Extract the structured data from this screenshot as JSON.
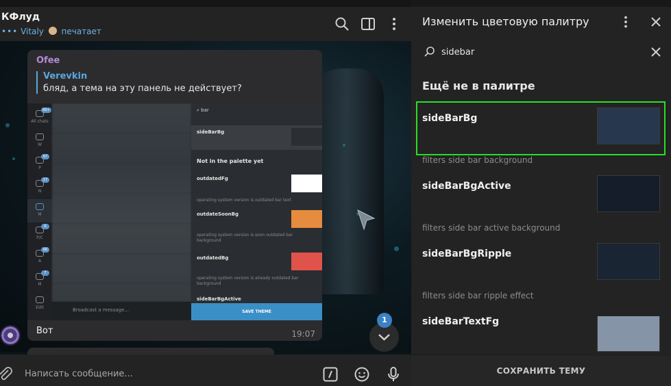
{
  "chat": {
    "title": "КФлуд",
    "status_dots": "•••",
    "status_user": "Vitaly",
    "status_text": "печатает",
    "message": {
      "author": "Ofee",
      "reply_author": "Verevkin",
      "reply_text": "бляд, а тема на эту панель не действует?",
      "text": "Вот",
      "time": "19:07"
    },
    "unread_count": "1",
    "composer_placeholder": "Написать сообщение..."
  },
  "screenshot": {
    "rail": [
      {
        "label": "All chats",
        "badge": "99+"
      },
      {
        "label": "W",
        "badge": ""
      },
      {
        "label": "P",
        "badge": "67"
      },
      {
        "label": "N",
        "badge": "17"
      },
      {
        "label": "M",
        "badge": ""
      },
      {
        "label": "P/C",
        "badge": "6"
      },
      {
        "label": "A",
        "badge": "66"
      },
      {
        "label": "M",
        "badge": "7"
      },
      {
        "label": "Edit",
        "badge": ""
      }
    ],
    "search": "bar",
    "compose_placeholder": "Broadcast a message...",
    "panel_items": [
      {
        "title": "sideBarBg",
        "desc": "",
        "color": "#2b2f34"
      },
      {
        "title": "outdatedFg",
        "desc": "operating system version is outdated bar text",
        "color": "#ffffff"
      },
      {
        "title": "outdateSoonBg",
        "desc": "operating system version is soon outdated bar background",
        "color": "#e68c3e"
      },
      {
        "title": "outdatedBg",
        "desc": "operating system version is already outdated bar background",
        "color": "#e0534a"
      },
      {
        "title": "sideBarBgActive",
        "desc": "",
        "color": "#2b2f34"
      }
    ],
    "section": "Not in the palette yet",
    "save_label": "SAVE THEME"
  },
  "panel": {
    "title": "Изменить цветовую палитру",
    "search_value": "sidebar",
    "section_title": "Ещё не в палитре",
    "items": [
      {
        "name": "sideBarBg",
        "desc": "filters side bar background",
        "color": "#27374d"
      },
      {
        "name": "sideBarBgActive",
        "desc": "filters side bar active background",
        "color": "#141d29"
      },
      {
        "name": "sideBarBgRipple",
        "desc": "filters side bar ripple effect",
        "color": "#1a2533"
      },
      {
        "name": "sideBarTextFg",
        "desc": "",
        "color": "#8594a6"
      }
    ],
    "save_label": "СОХРАНИТЬ ТЕМУ",
    "highlight_color": "#27e027"
  }
}
